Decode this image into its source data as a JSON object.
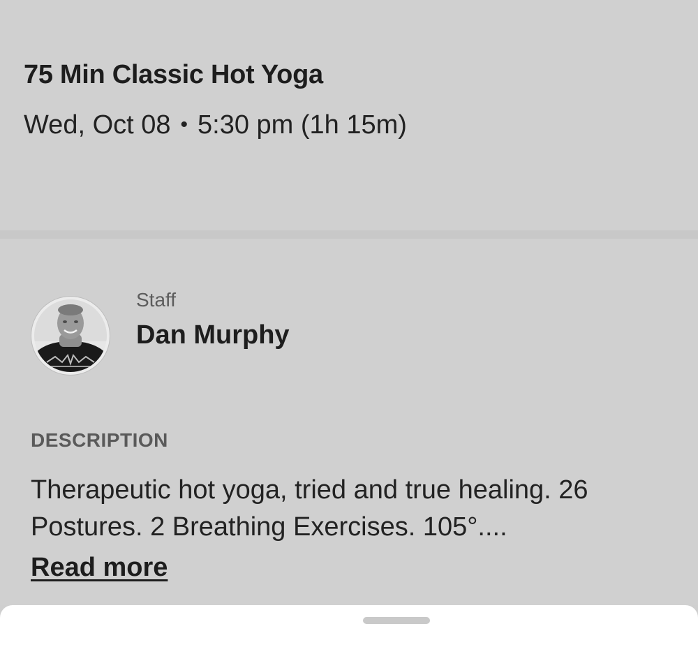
{
  "class": {
    "title": "75 Min Classic Hot Yoga",
    "date": "Wed, Oct 08",
    "separator": "•",
    "time": "5:30 pm (1h 15m)"
  },
  "staff": {
    "label": "Staff",
    "name": "Dan Murphy",
    "avatar_icon": "instructor-photo"
  },
  "description": {
    "label": "DESCRIPTION",
    "text": "Therapeutic hot yoga, tried and true healing. 26 Postures. 2 Breathing Exercises. 105°....",
    "read_more_label": "Read more"
  },
  "colors": {
    "background": "#d0d0d0",
    "sheet": "#ffffff",
    "text": "#1d1d1d",
    "muted": "#5c5c5c"
  }
}
